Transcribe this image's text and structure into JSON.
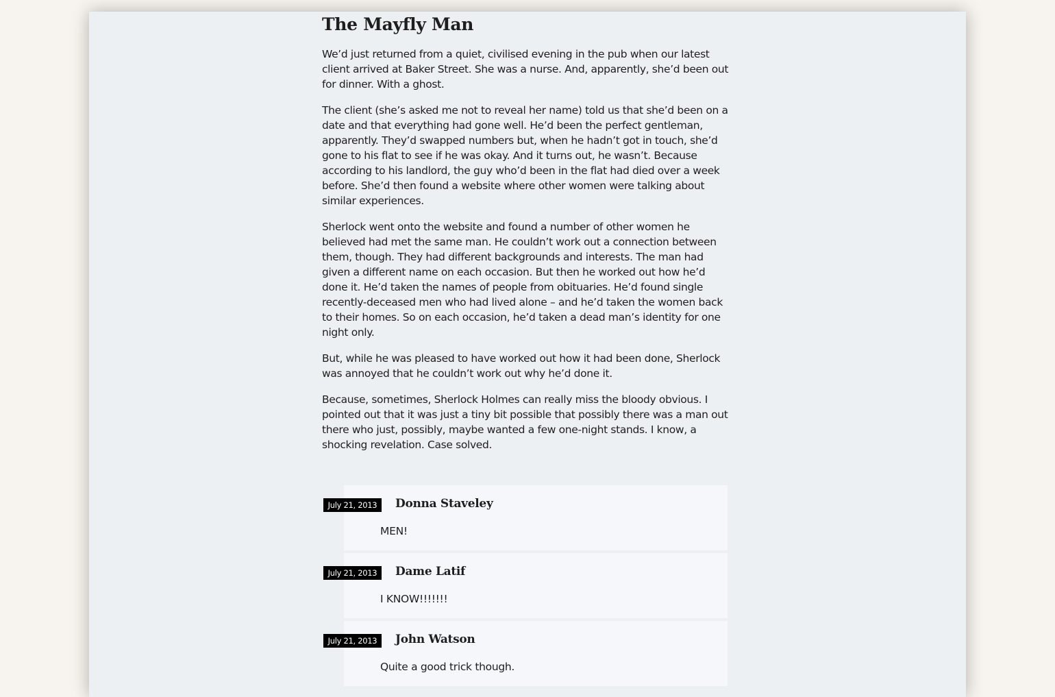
{
  "post": {
    "title": "The Mayfly Man",
    "paragraphs": [
      "We’d just returned from a quiet, civilised evening in the pub when our latest client arrived at Baker Street. She was a nurse. And, apparently, she’d been out for dinner. With a ghost.",
      "The client (she’s asked me not to reveal her name) told us that she’d been on a date and that everything had gone well. He’d been the perfect gentleman, apparently. They’d swapped numbers but, when he hadn’t got in touch, she’d gone to his flat to see if he was okay. And it turns out, he wasn’t. Because according to his landlord, the guy who’d been in the flat had died over a week before. She’d then found a website where other women were talking about similar experiences.",
      "Sherlock went onto the website and found a number of other women he believed had met the same man. He couldn’t work out a connection between them, though. They had different backgrounds and interests. The man had given a different name on each occasion. But then he worked out how he’d done it. He’d taken the names of people from obituaries. He’d found single recently-deceased men who had lived alone – and he’d taken the women back to their homes. So on each occasion, he’d taken a dead man’s identity for one night only.",
      "But, while he was pleased to have worked out how it had been done, Sherlock was annoyed that he couldn’t work out why he’d done it.",
      "Because, sometimes, Sherlock Holmes can really miss the bloody obvious. I pointed out that it was just a tiny bit possible that possibly there was a man out there who just, possibly, maybe wanted a few one-night stands. I know, a shocking revelation. Case solved."
    ]
  },
  "comments": [
    {
      "date": "July 21, 2013",
      "author": "Donna Staveley",
      "text": "MEN!"
    },
    {
      "date": "July 21, 2013",
      "author": "Dame Latif",
      "text": "I KNOW!!!!!!!"
    },
    {
      "date": "July 21, 2013",
      "author": "John Watson",
      "text": "Quite a good trick though."
    }
  ],
  "colors": {
    "background": "#f7f3ee",
    "page": "#edf0f2",
    "comment_card": "#f6f7fb",
    "date_badge": "#000000"
  }
}
